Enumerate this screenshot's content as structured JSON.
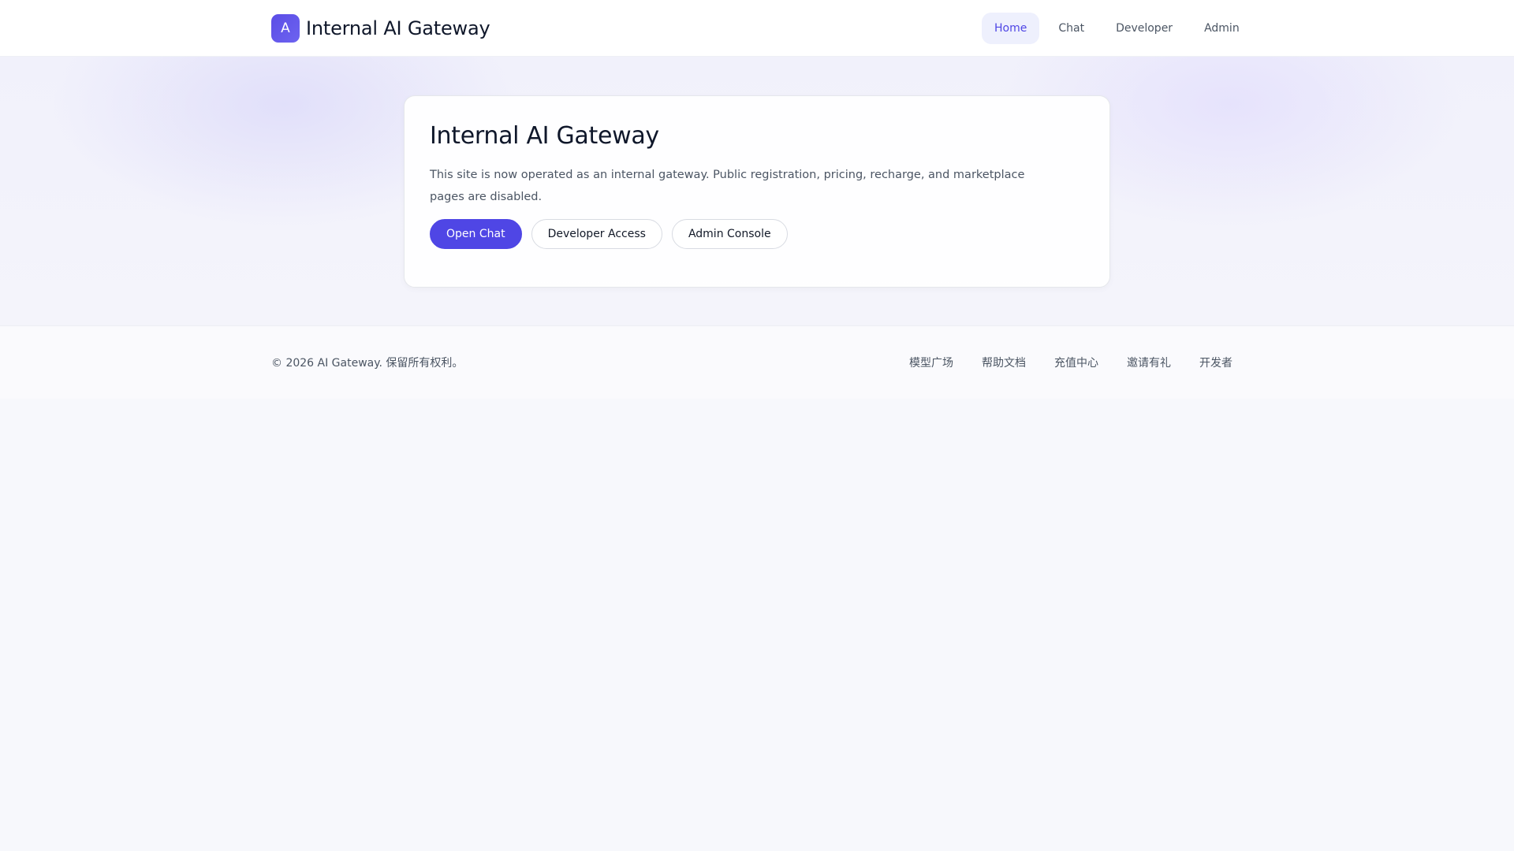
{
  "header": {
    "logo_letter": "A",
    "brand_name": "Internal AI Gateway",
    "nav": [
      {
        "label": "Home",
        "active": true
      },
      {
        "label": "Chat",
        "active": false
      },
      {
        "label": "Developer",
        "active": false
      },
      {
        "label": "Admin",
        "active": false
      }
    ]
  },
  "main": {
    "title": "Internal AI Gateway",
    "description": "This site is now operated as an internal gateway. Public registration, pricing, recharge, and marketplace pages are disabled.",
    "actions": {
      "open_chat": "Open Chat",
      "developer_access": "Developer Access",
      "admin_console": "Admin Console"
    }
  },
  "footer": {
    "copyright": "© 2026 AI Gateway. 保留所有权利。",
    "links": [
      "模型广场",
      "帮助文档",
      "充值中心",
      "邀请有礼",
      "开发者"
    ]
  },
  "colors": {
    "accent": "#4f46e5",
    "active_nav_bg": "#eef0fd"
  }
}
